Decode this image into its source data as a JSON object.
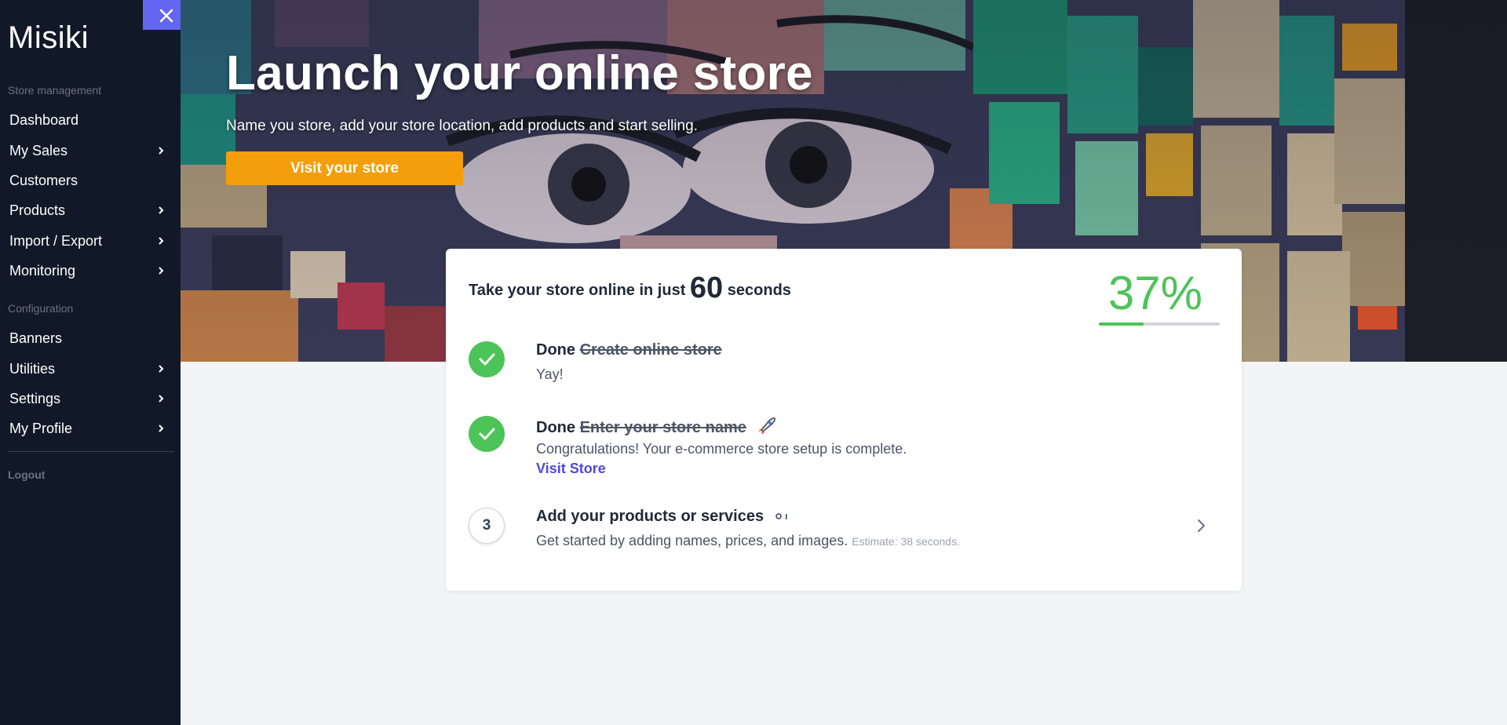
{
  "brand": "Misiki",
  "close_icon": "close-icon",
  "sidebar": {
    "sections": [
      {
        "label": "Store management"
      },
      {
        "label": "Configuration"
      }
    ],
    "items": [
      {
        "label": "Dashboard",
        "chevron": false
      },
      {
        "label": "My Sales",
        "chevron": true
      },
      {
        "label": "Customers",
        "chevron": false
      },
      {
        "label": "Products",
        "chevron": true
      },
      {
        "label": "Import / Export",
        "chevron": true
      },
      {
        "label": "Monitoring",
        "chevron": true
      },
      {
        "label": "Banners",
        "chevron": false
      },
      {
        "label": "Utilities",
        "chevron": true
      },
      {
        "label": "Settings",
        "chevron": true
      },
      {
        "label": "My Profile",
        "chevron": true
      }
    ],
    "logout": "Logout"
  },
  "hero": {
    "title": "Launch your online store",
    "subtitle": "Name you store, add your store location, add products and start selling.",
    "button": "Visit your store"
  },
  "card": {
    "head_prefix": "Take your store online in just",
    "head_number": "60",
    "head_suffix": "seconds",
    "progress_label": "37%",
    "progress_value": 0.37,
    "accent": "#4cc458",
    "steps": [
      {
        "status": "done",
        "done_label": "Done",
        "title": "Create online store",
        "desc": "Yay!"
      },
      {
        "status": "done",
        "done_label": "Done",
        "title": "Enter your store name",
        "icon": "rocket-icon",
        "desc": "Congratulations! Your e-commerce store setup is complete.",
        "link": "Visit Store"
      },
      {
        "status": "pending",
        "number": "3",
        "title": "Add your products or services",
        "icon": "loading-icon",
        "desc": "Get started by adding names, prices, and images.",
        "estimate": "Estimate: 38 seconds."
      }
    ]
  }
}
